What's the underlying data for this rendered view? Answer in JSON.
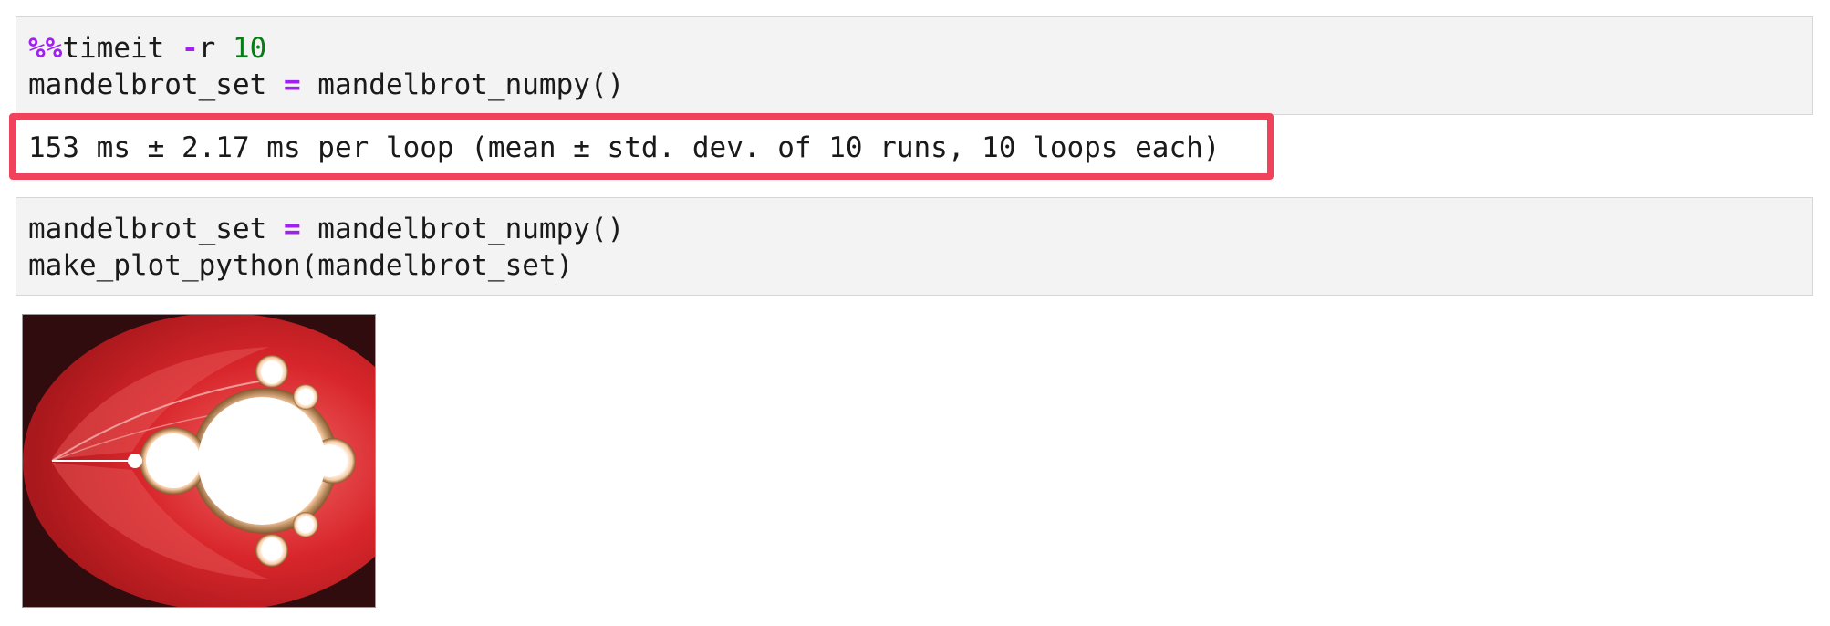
{
  "cells": [
    {
      "input": {
        "line1": {
          "magic": "%%",
          "cmd": "timeit ",
          "flag": "-",
          "flag_name": "r ",
          "num": "10"
        },
        "line2": {
          "var": "mandelbrot_set ",
          "op": "=",
          "call": " mandelbrot_numpy()"
        }
      },
      "output": "153 ms ± 2.17 ms per loop (mean ± std. dev. of 10 runs, 10 loops each)"
    },
    {
      "input": {
        "line1": {
          "var": "mandelbrot_set ",
          "op": "=",
          "call": " mandelbrot_numpy()"
        },
        "line2": "make_plot_python(mandelbrot_set)"
      },
      "output_image": "mandelbrot-set-plot"
    }
  ],
  "colors": {
    "highlight_border": "#f0435b",
    "keyword": "#a020f0",
    "number": "#067d17",
    "cell_bg": "#f3f3f3"
  }
}
